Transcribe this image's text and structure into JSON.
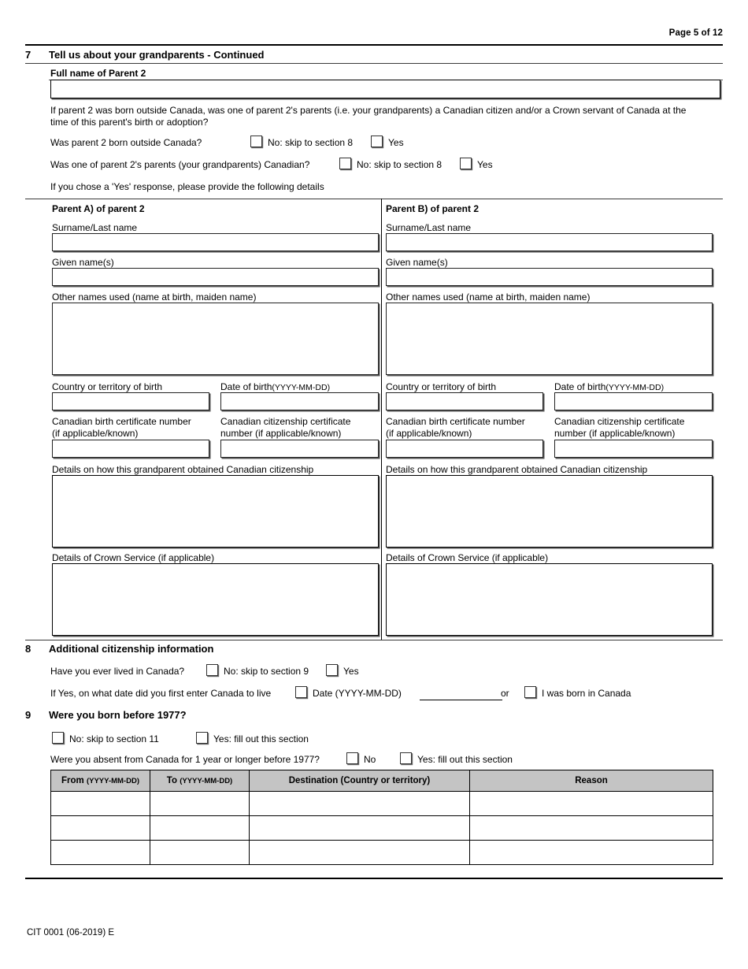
{
  "header": {
    "page_label": "Page 5 of 12"
  },
  "section7": {
    "number": "7",
    "title": "Tell us about your grandparents - Continued",
    "full_name_label": "Full name of Parent 2",
    "full_name_value": "",
    "intro_line1": "If parent 2 was born outside Canada, was one of parent 2's parents (i.e. your grandparents) a Canadian citizen and/or a Crown servant of Canada at the",
    "intro_line2": "time of this parent's birth or adoption?",
    "q1": {
      "question": "Was parent 2 born outside Canada?",
      "no_label": "No: skip to section 8",
      "yes_label": "Yes"
    },
    "q2": {
      "question": "Was one of parent 2's parents (your grandparents) Canadian?",
      "no_label": "No: skip to section 8",
      "yes_label": "Yes"
    },
    "if_yes_note": "If you chose a 'Yes' response, please provide the following details",
    "columns": [
      {
        "title": "Parent A) of parent 2",
        "surname_label": "Surname/Last name",
        "surname_value": "",
        "given_label": "Given name(s)",
        "given_value": "",
        "other_names_label": "Other names used (name at birth, maiden name)",
        "other_names_value": "",
        "country_label": "Country or territory of birth",
        "country_value": "",
        "dob_label": "Date of birth",
        "dob_format": "(YYYY-MM-DD)",
        "dob_value": "",
        "birth_cert_label_l1": "Canadian birth certificate number",
        "birth_cert_label_l2": "(if applicable/known)",
        "birth_cert_value": "",
        "citizenship_cert_label_l1": "Canadian citizenship certificate",
        "citizenship_cert_label_l2": "number (if applicable/known)",
        "citizenship_cert_value": "",
        "how_obtained_label": "Details on how this grandparent obtained Canadian citizenship",
        "how_obtained_value": "",
        "crown_service_label": "Details of Crown Service (if applicable)",
        "crown_service_value": ""
      },
      {
        "title": "Parent B) of parent 2",
        "surname_label": "Surname/Last name",
        "surname_value": "",
        "given_label": "Given name(s)",
        "given_value": "",
        "other_names_label": "Other names used (name at birth, maiden name)",
        "other_names_value": "",
        "country_label": "Country or territory of birth",
        "country_value": "",
        "dob_label": "Date of birth",
        "dob_format": "(YYYY-MM-DD)",
        "dob_value": "",
        "birth_cert_label_l1": "Canadian birth certificate number",
        "birth_cert_label_l2": "(if applicable/known)",
        "birth_cert_value": "",
        "citizenship_cert_label_l1": "Canadian citizenship certificate",
        "citizenship_cert_label_l2": "number (if applicable/known)",
        "citizenship_cert_value": "",
        "how_obtained_label": "Details on how this grandparent obtained Canadian citizenship",
        "how_obtained_value": "",
        "crown_service_label": "Details of Crown Service (if applicable)",
        "crown_service_value": ""
      }
    ]
  },
  "section8": {
    "number": "8",
    "title": "Additional citizenship information",
    "q1": {
      "question": "Have you ever lived in Canada?",
      "no_label": "No: skip to section 9",
      "yes_label": "Yes"
    },
    "q2": {
      "question": "If Yes, on what date did you first enter Canada to live",
      "date_label": "Date (YYYY-MM-DD)",
      "date_value": "",
      "or_label": "or",
      "born_label": "I was born in Canada"
    }
  },
  "section9": {
    "number": "9",
    "title": "Were you born before 1977?",
    "no_label": "No: skip to section 11",
    "yes_label": "Yes: fill out this section",
    "absence_question": "Were you absent from Canada for 1 year or longer before 1977?",
    "absence_no_label": "No",
    "absence_yes_label": "Yes: fill out this section",
    "table": {
      "headers": [
        {
          "main": "From ",
          "format": "(YYYY-MM-DD)"
        },
        {
          "main": "To ",
          "format": "(YYYY-MM-DD)"
        },
        {
          "main": "Destination (Country or territory)",
          "format": ""
        },
        {
          "main": "Reason",
          "format": ""
        }
      ],
      "rows": [
        {
          "from": "",
          "to": "",
          "destination": "",
          "reason": ""
        },
        {
          "from": "",
          "to": "",
          "destination": "",
          "reason": ""
        },
        {
          "from": "",
          "to": "",
          "destination": "",
          "reason": ""
        }
      ]
    }
  },
  "footer": {
    "form_code": "CIT 0001 (06-2019) E"
  }
}
